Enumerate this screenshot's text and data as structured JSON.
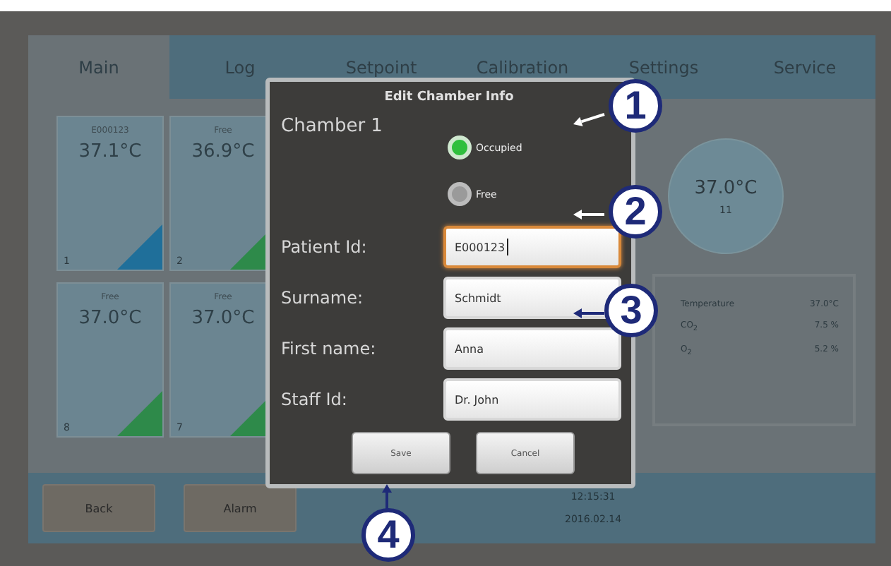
{
  "tabs": [
    {
      "label": "Main",
      "selected": true
    },
    {
      "label": "Log",
      "selected": false
    },
    {
      "label": "Setpoint",
      "selected": false
    },
    {
      "label": "Calibration",
      "selected": false
    },
    {
      "label": "Settings",
      "selected": false
    },
    {
      "label": "Service",
      "selected": false
    }
  ],
  "tiles": [
    {
      "status": "E000123",
      "temperature": "37.1°C",
      "number": "1",
      "color": "#1f6f9a"
    },
    {
      "status": "Free",
      "temperature": "36.9°C",
      "number": "2",
      "color": "#2e8a4a"
    },
    {
      "status": "Free",
      "temperature": "37.0°C",
      "number": "8",
      "color": "#2e8a4a"
    },
    {
      "status": "Free",
      "temperature": "37.0°C",
      "number": "7",
      "color": "#2e8a4a"
    }
  ],
  "gauge": {
    "temperature": "37.0°C",
    "label": "11"
  },
  "readings": [
    {
      "name": "Temperature",
      "value": "37.0°C"
    },
    {
      "name": "CO$_{2}$",
      "value": "7.5 %"
    },
    {
      "name": "O$_{2}$",
      "value": "5.2 %"
    }
  ],
  "bottom_buttons": [
    "Back",
    "Alarm"
  ],
  "clock": {
    "time": "12:15:31",
    "date": "2016.02.14"
  },
  "dialog": {
    "title": "Edit Chamber Info",
    "chamber": "Chamber 1",
    "options": [
      {
        "label": "Occupied",
        "selected": true
      },
      {
        "label": "Free",
        "selected": false
      }
    ],
    "fields": [
      {
        "label": "Patient Id:",
        "value": "E000123",
        "focused": true
      },
      {
        "label": "Surname:",
        "value": "Schmidt",
        "focused": false
      },
      {
        "label": "First name:",
        "value": "Anna",
        "focused": false
      },
      {
        "label": "Staff Id:",
        "value": "Dr. John",
        "focused": false
      }
    ],
    "buttons": [
      "Save",
      "Cancel"
    ]
  },
  "callouts": [
    {
      "number": "1"
    },
    {
      "number": "2"
    },
    {
      "number": "3"
    },
    {
      "number": "4"
    }
  ]
}
